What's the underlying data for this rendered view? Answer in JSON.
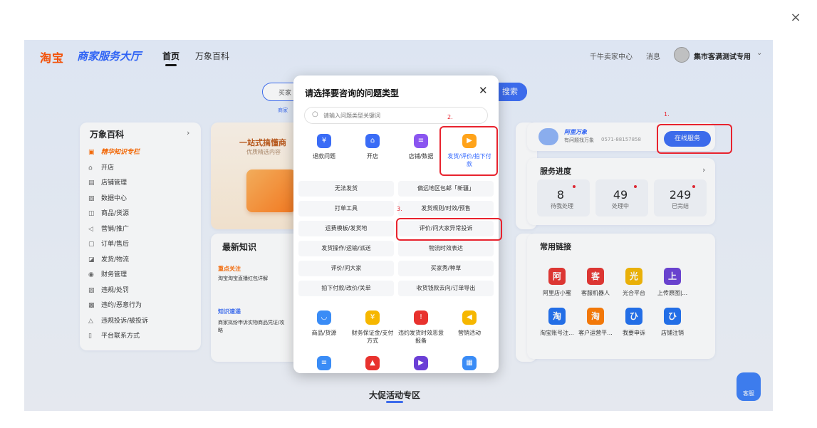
{
  "close_symbol": "×",
  "nav": {
    "logo": "淘宝",
    "brand": "商家服务大厅",
    "tabs": [
      "首页",
      "万象百科"
    ],
    "seller_center": "千牛卖家中心",
    "messages": "消息",
    "user": "集市客满测试专用"
  },
  "search": {
    "placeholder_partial": "买家",
    "button": "搜索",
    "hint_partial": "商家"
  },
  "sidebar": {
    "title": "万象百科",
    "items": [
      {
        "icon": "knowledge-icon",
        "label": "精华知识专栏",
        "highlight": true
      },
      {
        "icon": "home-icon",
        "label": "开店"
      },
      {
        "icon": "shop-icon",
        "label": "店铺管理"
      },
      {
        "icon": "data-icon",
        "label": "数据中心"
      },
      {
        "icon": "goods-icon",
        "label": "商品/货源"
      },
      {
        "icon": "marketing-icon",
        "label": "营销/推广"
      },
      {
        "icon": "order-icon",
        "label": "订单/售后"
      },
      {
        "icon": "delivery-icon",
        "label": "发货/物流"
      },
      {
        "icon": "finance-icon",
        "label": "财务管理"
      },
      {
        "icon": "violation-icon",
        "label": "违规/处罚"
      },
      {
        "icon": "contract-icon",
        "label": "违约/恶意行为"
      },
      {
        "icon": "complaint-icon",
        "label": "违规投诉/被投诉"
      },
      {
        "icon": "contact-icon",
        "label": "平台联系方式"
      }
    ]
  },
  "banner": {
    "title_partial": "一站式搞懂商",
    "subtitle_partial": "优质精选内容"
  },
  "latest": {
    "title": "最新知识",
    "focus_title": "重点关注",
    "focus_text": "淘宝淘宝直播红包详解",
    "express_title": "知识速递",
    "express_text": "商家拟纷申诉实物商品凭证/攻略"
  },
  "service": {
    "name": "阿里万象",
    "sub": "有问题找万象",
    "phone": "0571-88157858",
    "online_btn": "在线服务",
    "progress_title": "服务进度",
    "stats": [
      {
        "value": "8",
        "label": "待我处理"
      },
      {
        "value": "49",
        "label": "处理中"
      },
      {
        "value": "249",
        "label": "已完结"
      }
    ]
  },
  "links": {
    "title": "常用链接",
    "items": [
      {
        "glyph": "阿",
        "label": "阿里店小蜜",
        "color": "#e8322e"
      },
      {
        "glyph": "客",
        "label": "客服机器人",
        "color": "#e8322e"
      },
      {
        "glyph": "光",
        "label": "光合平台",
        "color": "#f6b700"
      },
      {
        "glyph": "上",
        "label": "上传原图|...",
        "color": "#6b3fd6"
      },
      {
        "glyph": "淘",
        "label": "淘宝账号注...",
        "color": "#1f6ff0"
      },
      {
        "glyph": "淘",
        "label": "客户运营平...",
        "color": "#ff7a00"
      },
      {
        "glyph": "ひ",
        "label": "我要申诉",
        "color": "#1f6ff0"
      },
      {
        "glyph": "ひ",
        "label": "店铺注销",
        "color": "#1f6ff0"
      }
    ]
  },
  "bottom": {
    "title": "大促活动专区",
    "robot": "客服"
  },
  "modal": {
    "title": "请选择要咨询的问题类型",
    "search_placeholder": "请输入问题类型关键词",
    "categories_top": [
      {
        "icon": "refund-icon",
        "glyph": "¥",
        "label": "退款问题",
        "color": "#3a6cf6"
      },
      {
        "icon": "open-shop-icon",
        "glyph": "⌂",
        "label": "开店",
        "color": "#3a6cf6"
      },
      {
        "icon": "shop-data-icon",
        "glyph": "≡",
        "label": "店铺/数据",
        "color": "#8a55f0"
      },
      {
        "icon": "truck-icon",
        "glyph": "▶",
        "label": "发货/评价/拍下付款",
        "color": "#ffa31a"
      }
    ],
    "options": [
      "无法发货",
      "偏远地区包邮「新疆」",
      "打单工具",
      "发货规则/时效/预售",
      "运费模板/发货地",
      "评价/问大家异常投诉",
      "发货操作/运输/派送",
      "物流时效表达",
      "评价/问大家",
      "买家秀/种草",
      "拍下付款/改价/关单",
      "收货钱款去向/订单导出"
    ],
    "categories_bottom": [
      {
        "icon": "goods-icon",
        "glyph": "◡",
        "label": "商品/货源",
        "color": "#3a8cf6"
      },
      {
        "icon": "deposit-icon",
        "glyph": "¥",
        "label": "财务保证金/支付方式",
        "color": "#f6b700"
      },
      {
        "icon": "alert-icon",
        "glyph": "!",
        "label": "违约发货时效恶意报备",
        "color": "#e8322e"
      },
      {
        "icon": "megaphone-icon",
        "glyph": "◀",
        "label": "营销活动",
        "color": "#f6b700"
      }
    ],
    "categories_third": [
      {
        "icon": "chat-icon",
        "glyph": "≡",
        "color": "#3a8cf6"
      },
      {
        "icon": "warning-icon",
        "glyph": "▲",
        "color": "#e8322e"
      },
      {
        "icon": "video-icon",
        "glyph": "▶",
        "color": "#6b3fd6"
      },
      {
        "icon": "grid-icon",
        "glyph": "▦",
        "color": "#3a8cf6"
      }
    ]
  },
  "annotations": [
    "1.",
    "2.",
    "3."
  ]
}
